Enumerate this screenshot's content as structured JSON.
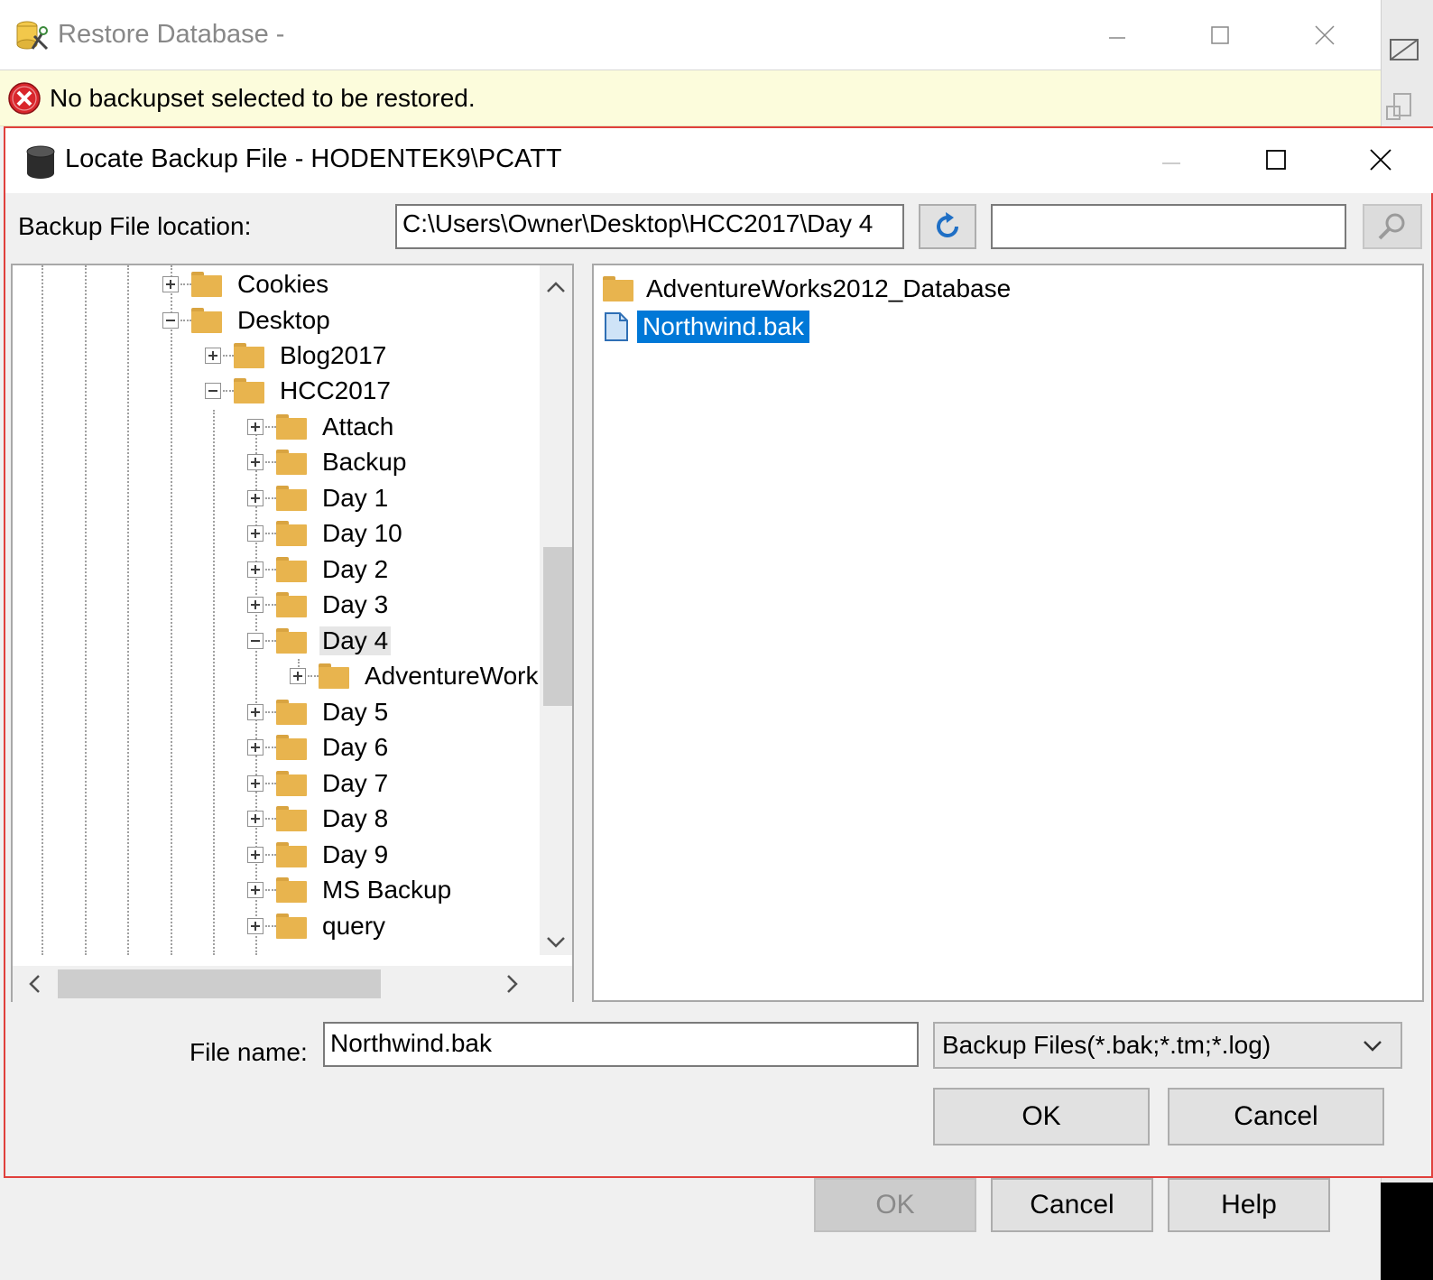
{
  "background_window": {
    "title": "Restore Database -",
    "alert_text": "No backupset selected to be restored.",
    "buttons": {
      "ok": "OK",
      "cancel": "Cancel",
      "help": "Help"
    }
  },
  "dialog": {
    "title": "Locate Backup File - HODENTEK9\\PCATT",
    "location_label": "Backup File location:",
    "location_value": "C:\\Users\\Owner\\Desktop\\HCC2017\\Day 4",
    "search_value": "",
    "tree": [
      {
        "label": "Cookies",
        "state": "collapsed"
      },
      {
        "label": "Desktop",
        "state": "expanded"
      },
      {
        "label": "Blog2017",
        "state": "collapsed"
      },
      {
        "label": "HCC2017",
        "state": "expanded"
      },
      {
        "label": "Attach",
        "state": "collapsed"
      },
      {
        "label": "Backup",
        "state": "collapsed"
      },
      {
        "label": "Day 1",
        "state": "collapsed"
      },
      {
        "label": "Day 10",
        "state": "collapsed"
      },
      {
        "label": "Day 2",
        "state": "collapsed"
      },
      {
        "label": "Day 3",
        "state": "collapsed"
      },
      {
        "label": "Day 4",
        "state": "expanded",
        "selected": true
      },
      {
        "label": "AdventureWork",
        "state": "collapsed"
      },
      {
        "label": "Day 5",
        "state": "collapsed"
      },
      {
        "label": "Day 6",
        "state": "collapsed"
      },
      {
        "label": "Day 7",
        "state": "collapsed"
      },
      {
        "label": "Day 8",
        "state": "collapsed"
      },
      {
        "label": "Day 9",
        "state": "collapsed"
      },
      {
        "label": "MS Backup",
        "state": "collapsed"
      },
      {
        "label": "query",
        "state": "collapsed"
      }
    ],
    "files": [
      {
        "label": "AdventureWorks2012_Database",
        "type": "folder"
      },
      {
        "label": "Northwind.bak",
        "type": "file",
        "selected": true
      }
    ],
    "file_name_label": "File name:",
    "file_name_value": "Northwind.bak",
    "filter_value": "Backup Files(*.bak;*.tm;*.log)",
    "ok": "OK",
    "cancel": "Cancel"
  },
  "colors": {
    "selection": "#0078d7",
    "alert_bg": "#fcfcdc",
    "dialog_border": "#e0403c",
    "folder": "#e8b44e"
  },
  "icons": [
    "restore-db-icon",
    "error-icon",
    "database-icon",
    "refresh-icon",
    "search-icon",
    "folder-icon",
    "file-icon",
    "chevron-down-icon"
  ]
}
